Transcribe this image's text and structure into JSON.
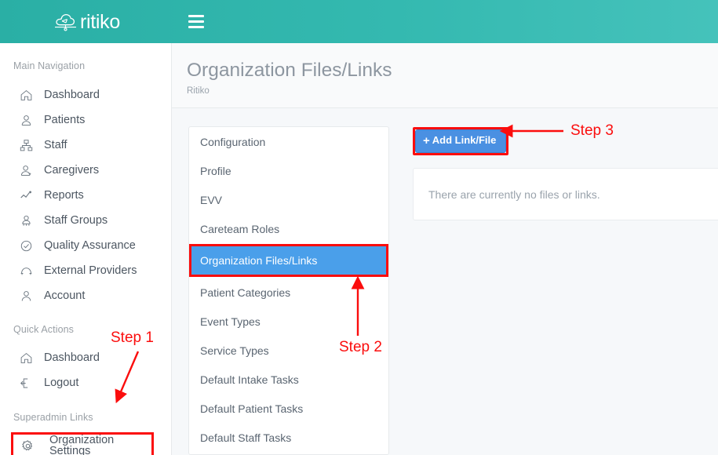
{
  "topbar": {
    "brand_name": "ritiko",
    "logo_icon": "cloud-network-icon",
    "menu_icon": "hamburger-menu-icon"
  },
  "sidebar": {
    "sections": [
      {
        "heading": "Main Navigation",
        "items": [
          {
            "label": "Dashboard",
            "icon": "home-icon"
          },
          {
            "label": "Patients",
            "icon": "user-icon"
          },
          {
            "label": "Staff",
            "icon": "sitemap-icon"
          },
          {
            "label": "Caregivers",
            "icon": "user-plus-icon"
          },
          {
            "label": "Reports",
            "icon": "line-chart-icon"
          },
          {
            "label": "Staff Groups",
            "icon": "user-group-icon"
          },
          {
            "label": "Quality Assurance",
            "icon": "check-circle-icon"
          },
          {
            "label": "External Providers",
            "icon": "providers-icon"
          },
          {
            "label": "Account",
            "icon": "account-icon"
          }
        ]
      },
      {
        "heading": "Quick Actions",
        "items": [
          {
            "label": "Dashboard",
            "icon": "home-icon"
          },
          {
            "label": "Logout",
            "icon": "logout-icon"
          }
        ]
      },
      {
        "heading": "Superadmin Links",
        "items": [
          {
            "label": "Organization Settings",
            "icon": "gear-icon",
            "highlighted": true
          }
        ]
      }
    ]
  },
  "page": {
    "title": "Organization Files/Links",
    "subtitle": "Ritiko"
  },
  "settings_menu": {
    "items": [
      {
        "label": "Configuration",
        "active": false
      },
      {
        "label": "Profile",
        "active": false
      },
      {
        "label": "EVV",
        "active": false
      },
      {
        "label": "Careteam Roles",
        "active": false
      },
      {
        "label": "Organization Files/Links",
        "active": true
      },
      {
        "label": "Patient Categories",
        "active": false
      },
      {
        "label": "Event Types",
        "active": false
      },
      {
        "label": "Service Types",
        "active": false
      },
      {
        "label": "Default Intake Tasks",
        "active": false
      },
      {
        "label": "Default Patient Tasks",
        "active": false
      },
      {
        "label": "Default Staff Tasks",
        "active": false
      }
    ]
  },
  "files_panel": {
    "add_button_label": "Add Link/File",
    "add_button_icon": "plus-icon",
    "empty_message": "There are currently no files or links."
  },
  "annotations": {
    "step1": "Step 1",
    "step2": "Step 2",
    "step3": "Step 3",
    "color": "#fb0d0d"
  },
  "colors": {
    "topbar_teal": "#34b9b0",
    "accent_blue": "#4a90e2",
    "annotation_red": "#fb0d0d",
    "active_item_blue": "#4a9fea"
  }
}
